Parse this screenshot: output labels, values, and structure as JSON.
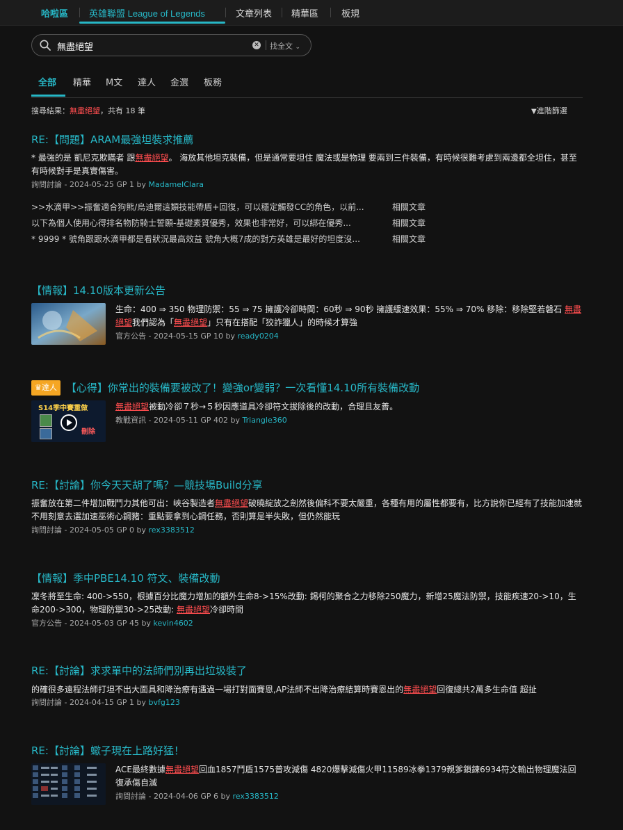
{
  "topnav": {
    "brand": "哈啦區",
    "game": "英雄聯盟 League of Legends",
    "items": [
      "文章列表",
      "精華區",
      "板規"
    ]
  },
  "search": {
    "query": "無盡絕望",
    "scope": "找全文"
  },
  "tabs": [
    "全部",
    "精華",
    "M文",
    "達人",
    "金選",
    "板務"
  ],
  "results_header": {
    "prefix": "搜尋結果：",
    "keyword": "無盡絕望",
    "suffix": "，共有 18 筆",
    "advanced": "進階篩選"
  },
  "colors": {
    "accent": "#27b7c6",
    "highlight": "#ff4d4f",
    "badge": "#f5a623"
  },
  "results": [
    {
      "title": "RE:【問題】ARAM最強坦裝求推薦",
      "snippet_pre": "* 最強的是 凱尼克欺瞞者 跟",
      "snippet_hl": "無盡絕望",
      "snippet_post": "。 海放其他坦克裝備，但是通常要坦住 魔法或是物理 要兩到三件裝備，有時候很難考慮到兩邊都全坦住，甚至有時候對手是真實傷害。",
      "meta": "詢問討論 - 2024-05-25   GP 1   by",
      "author": "MadameIClara",
      "related": [
        {
          "text": ">>水滴甲>>振奮適合狗熊/烏迪爾這類技能帶盾+回復，可以穩定觸發CC的角色，以前...",
          "link": "相關文章"
        },
        {
          "text": "以下為個人使用心得排名物防騎士誓願-基礎素質優秀，效果也非常好，可以綁在優秀...",
          "link": "相關文章"
        },
        {
          "text": "* 9999 * 號角跟跟水滴甲都是看狀況最高效益 號角大概7成的對方英雄是最好的坦度沒...",
          "link": "相關文章"
        }
      ]
    },
    {
      "title": "【情報】14.10版本更新公告",
      "snippet_pre": "生命：400 ⇒ 350 物理防禦：55 ⇒ 75 擁護冷卻時間：60秒 ⇒ 90秒 擁護緩速效果：55% ⇒ 70% 移除：移除堅若磐石 ",
      "snippet_hl": "無盡絕望",
      "snippet_mid": "我們認為「",
      "snippet_hl2": "無盡絕望",
      "snippet_post": "」只有在搭配「狡詐獵人」的時候才算強",
      "meta": "官方公告 - 2024-05-15   GP 10   by",
      "author": "ready0204"
    },
    {
      "badge": "達人",
      "title": "【心得】你常出的裝備要被改了！變強or變弱？一次看懂14.10所有裝備改動",
      "thumb_label": "S14季中賽重做",
      "thumb_label2": "刪除",
      "snippet_pre": "",
      "snippet_hl": "無盡絕望",
      "snippet_post": "被動冷卻７秒→５秒因應道具冷卻符文拔除後的改動，合理且友善。",
      "meta": "教戰資訊 - 2024-05-11   GP 402   by",
      "author": "Triangle360"
    },
    {
      "title": "RE:【討論】你今天天胡了嗎？—競技場Build分享",
      "snippet_pre": "振奮放在第二件增加戰鬥力其他可出：峽谷製造者",
      "snippet_hl": "無盡絕望",
      "snippet_post": "破曉綻放之劍然後偏科不要太嚴重，各種有用的屬性都要有，比方說你已經有了技能加速就不用刻意去選加速巫術心鋼豬：重點要拿到心鋼任務，否則算是半失敗，但仍然能玩",
      "meta": "詢問討論 - 2024-05-05   GP 0   by",
      "author": "rex3383512"
    },
    {
      "title": "【情報】季中PBE14.10 符文、裝備改動",
      "snippet_pre": "凜冬將至生命: 400->550，根據百分比魔力增加的額外生命8->15%改動: 錫柯的聚合之力移除250魔力，新增25魔法防禦，技能疾速20->10，生命200->300，物理防禦30->25改動: ",
      "snippet_hl": "無盡絕望",
      "snippet_post": "冷卻時間",
      "meta": "官方公告 - 2024-05-03   GP 45   by",
      "author": "kevin4602"
    },
    {
      "title": "RE:【討論】求求單中的法師們別再出垃圾裝了",
      "snippet_pre": "的確很多遠程法師打坦不出大面具和降治療有遇過一場打對面賽恩,AP法師不出降治療結算時賽恩出的",
      "snippet_hl": "無盡絕望",
      "snippet_post": "回復總共2萬多生命值 超扯",
      "meta": "詢問討論 - 2024-04-15   GP 1   by",
      "author": "bvfg123"
    },
    {
      "title": "RE:【討論】蠍子現在上路好猛！",
      "snippet_pre": "ACE最終數據",
      "snippet_hl": "無盡絕望",
      "snippet_post": "回血1857鬥盾1575普攻減傷 4820爆擊減傷火甲11589冰拳1379親爹鎖鍊6934符文輸出物理魔法回復承傷自滅",
      "meta": "詢問討論 - 2024-04-06   GP 6   by",
      "author": "rex3383512"
    }
  ]
}
